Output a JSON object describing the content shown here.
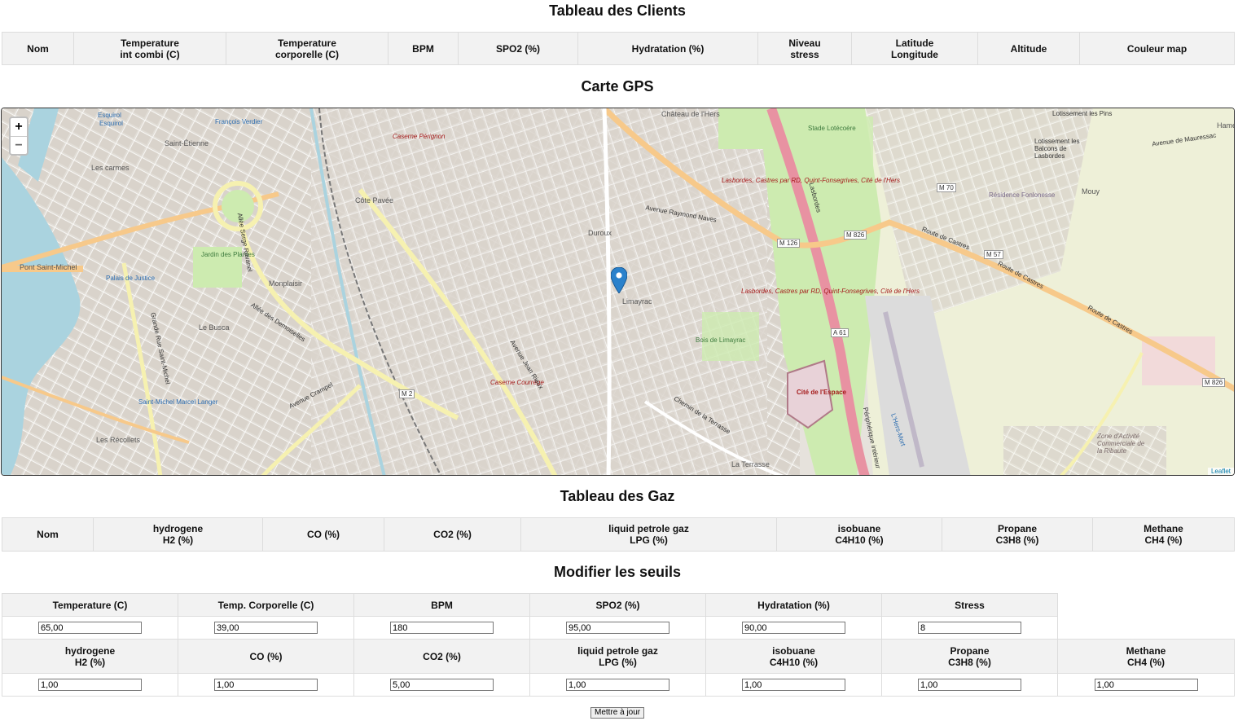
{
  "clients": {
    "title": "Tableau des Clients",
    "columns": [
      [
        "Nom"
      ],
      [
        "Temperature",
        "int combi (C)"
      ],
      [
        "Temperature",
        "corporelle (C)"
      ],
      [
        "BPM"
      ],
      [
        "SPO2 (%)"
      ],
      [
        "Hydratation (%)"
      ],
      [
        "Niveau",
        "stress"
      ],
      [
        "Latitude",
        "Longitude"
      ],
      [
        "Altitude"
      ],
      [
        "Couleur map"
      ]
    ]
  },
  "map": {
    "title": "Carte GPS",
    "zoom_in": "+",
    "zoom_out": "−",
    "attribution": "Leaflet",
    "labels": [
      "Esquirol",
      "Esquirol",
      "François Verdier",
      "Saint-Étienne",
      "Les carmes",
      "Château de l'Hers",
      "Caserne Pérignon",
      "Côte Pavée",
      "Duroux",
      "Limayrac",
      "Bois de Limayrac",
      "Monplaisir",
      "Le Busca",
      "Jardin des Plantes",
      "Palais de Justice",
      "Pont Saint-Michel",
      "Saint-Michel Marcel Langer",
      "Les Récollets",
      "Caserne Courrège",
      "Cité de l'Espace",
      "La Terrasse",
      "Stade Lotécoère",
      "Mouy",
      "Lotissement les Pins",
      "Lotissement les Balcons de Lasbordes",
      "Résidence Fonlonesse",
      "Zone d'Activité Commerciale de la Ribaute",
      "Hame",
      "Lasbordes, Castres par RD, Quint-Fonsegrives, Cité de l'Hers",
      "Lasbordes, Castres par RD, Quint-Fonsegrives, Cité de l'Hers",
      "Route de Castres",
      "Route de Castres",
      "Route de Castres",
      "Avenue Jean Rieux",
      "Allée des Demoiselles",
      "Avenue Crampel",
      "Allée Serge Ravanel",
      "Grande Rue Saint-Michel",
      "Chemin de la Terrasse",
      "Avenue Raymond Naves",
      "Avenue de Mauressac",
      "Périphérique intérieur",
      "Lasbordes",
      "L'Hers-Mort"
    ],
    "shields": [
      "M 126",
      "M 826",
      "M 57",
      "M 70",
      "A 61",
      "M 2",
      "M 826"
    ]
  },
  "gaz": {
    "title": "Tableau des Gaz",
    "columns": [
      [
        "Nom"
      ],
      [
        "hydrogene",
        "H2 (%)"
      ],
      [
        "CO (%)"
      ],
      [
        "CO2 (%)"
      ],
      [
        "liquid petrole gaz",
        "LPG (%)"
      ],
      [
        "isobuane",
        "C4H10 (%)"
      ],
      [
        "Propane",
        "C3H8 (%)"
      ],
      [
        "Methane",
        "CH4 (%)"
      ]
    ]
  },
  "seuils": {
    "title": "Modifier les seuils",
    "row1": [
      {
        "label": [
          "Temperature (C)"
        ],
        "value": "65,00"
      },
      {
        "label": [
          "Temp. Corporelle (C)"
        ],
        "value": "39,00"
      },
      {
        "label": [
          "BPM"
        ],
        "value": "180"
      },
      {
        "label": [
          "SPO2 (%)"
        ],
        "value": "95,00"
      },
      {
        "label": [
          "Hydratation (%)"
        ],
        "value": "90,00"
      },
      {
        "label": [
          "Stress"
        ],
        "value": "8"
      }
    ],
    "row2": [
      {
        "label": [
          "hydrogene",
          "H2 (%)"
        ],
        "value": "1,00"
      },
      {
        "label": [
          "CO (%)"
        ],
        "value": "1,00"
      },
      {
        "label": [
          "CO2 (%)"
        ],
        "value": "5,00"
      },
      {
        "label": [
          "liquid petrole gaz",
          "LPG (%)"
        ],
        "value": "1,00"
      },
      {
        "label": [
          "isobuane",
          "C4H10 (%)"
        ],
        "value": "1,00"
      },
      {
        "label": [
          "Propane",
          "C3H8 (%)"
        ],
        "value": "1,00"
      },
      {
        "label": [
          "Methane",
          "CH4 (%)"
        ],
        "value": "1,00"
      }
    ],
    "submit_label": "Mettre à jour"
  },
  "colors": {
    "header_bg": "#f2f2f2",
    "border": "#dddddd",
    "marker": "#2a81cb",
    "major_road": "#f7c98a",
    "secondary_road": "#f6f1b0",
    "motorway": "#e892a2",
    "park": "#cdebb0",
    "river": "#aad3df"
  }
}
